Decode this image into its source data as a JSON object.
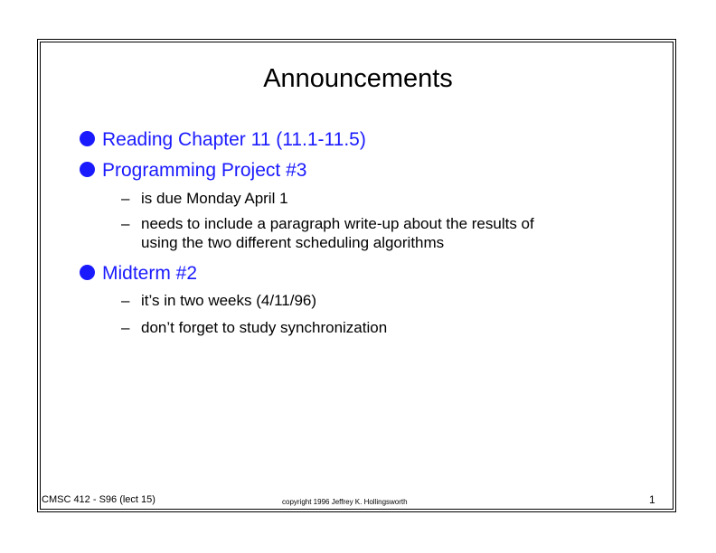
{
  "slide": {
    "title": "Announcements",
    "bullets": [
      {
        "text": "Reading Chapter 11 (11.1-11.5)",
        "subitems": []
      },
      {
        "text": "Programming Project #3",
        "subitems": [
          {
            "lines": [
              "is due Monday April 1"
            ]
          },
          {
            "lines": [
              "needs to include a paragraph write-up about the results of",
              "using the two different scheduling algorithms"
            ]
          }
        ]
      },
      {
        "text": "Midterm #2",
        "subitems": [
          {
            "lines": [
              "it’s in two weeks (4/11/96)"
            ]
          },
          {
            "lines": [
              "don’t forget to study synchronization"
            ]
          }
        ]
      }
    ],
    "dash_glyph": "–",
    "bullet_color": "#1a1aff",
    "footer": {
      "course": "CMSC 412 - S96  (lect 15)",
      "copyright": "copyright 1996  Jeffrey K. Hollingsworth",
      "page_number": "1"
    }
  }
}
